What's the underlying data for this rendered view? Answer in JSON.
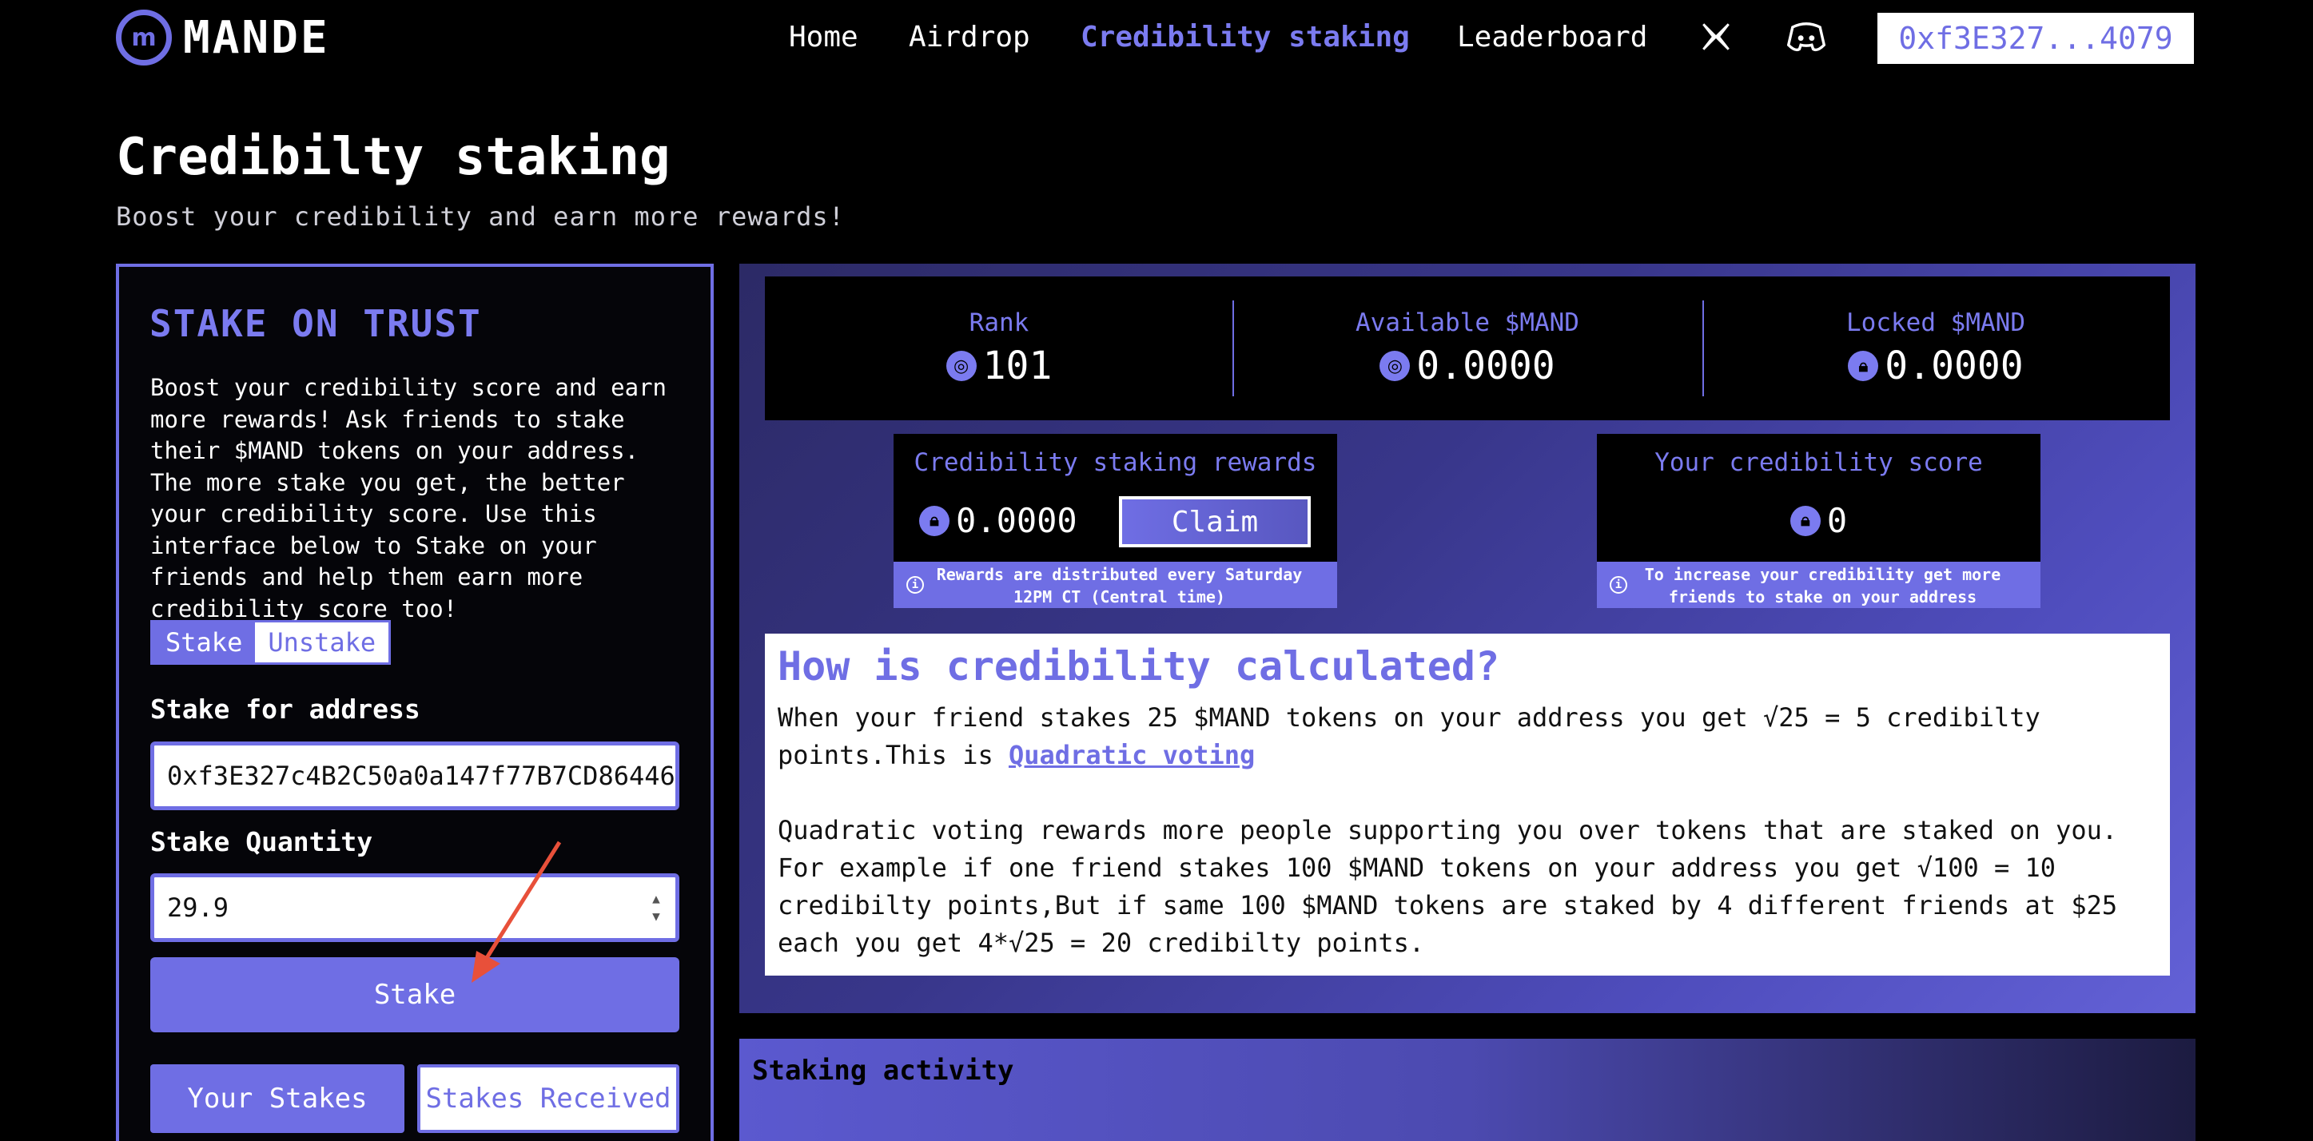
{
  "nav": {
    "logo_text": "MANDE",
    "links": [
      "Home",
      "Airdrop",
      "Credibility staking",
      "Leaderboard"
    ],
    "active_index": 2,
    "wallet": "0xf3E327...4079"
  },
  "header": {
    "title": "Credibilty staking",
    "subtitle": "Boost your credibility and earn more rewards!"
  },
  "stake_panel": {
    "title": "STAKE ON TRUST",
    "description": "Boost your credibility score and earn more rewards! Ask friends to stake their $MAND tokens on your address. The more stake you get, the better your credibility score. Use this interface below to Stake on your friends and help them earn more credibility score too!",
    "toggle": [
      "Stake",
      "Unstake"
    ],
    "address_label": "Stake for address",
    "address_value": "0xf3E327c4B2C50a0a147f77B7CD86446",
    "quantity_label": "Stake Quantity",
    "quantity_value": "29.9",
    "stake_button": "Stake",
    "your_stakes": "Your Stakes",
    "stakes_received": "Stakes Received"
  },
  "stats": {
    "rank_label": "Rank",
    "rank_value": "101",
    "available_label": "Available $MAND",
    "available_value": "0.0000",
    "locked_label": "Locked $MAND",
    "locked_value": "0.0000"
  },
  "rewards_card": {
    "title": "Credibility staking rewards",
    "value": "0.0000",
    "claim": "Claim",
    "note": "Rewards are distributed every Saturday 12PM CT (Central time)"
  },
  "score_card": {
    "title": "Your credibility score",
    "value": "0",
    "note": "To increase your credibility get more friends to stake on your address"
  },
  "info": {
    "title": "How is credibility calculated?",
    "p1": "When your friend stakes 25 $MAND tokens on your address you get √25 = 5 credibilty points.This is ",
    "link": "Quadratic voting",
    "p2": "Quadratic voting rewards more people supporting you over tokens that are staked on you. For example if one friend stakes 100 $MAND tokens on your address you get √100 = 10 credibilty points,But if same 100 $MAND tokens are staked by 4 different friends at $25 each you get 4*√25 = 20 credibilty points."
  },
  "activity": {
    "title": "Staking activity"
  },
  "colors": {
    "accent": "#6f6ee4",
    "background": "#000000"
  }
}
